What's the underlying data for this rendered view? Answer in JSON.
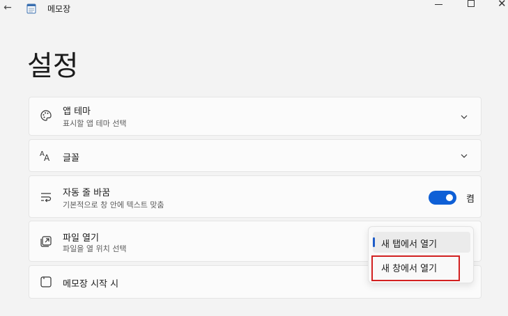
{
  "titlebar": {
    "app_title": "메모장",
    "back_icon": "arrow-left-icon",
    "app_icon": "notepad-icon"
  },
  "page": {
    "title": "설정"
  },
  "settings": [
    {
      "id": "theme",
      "label": "앱 테마",
      "description": "표시할 앱 테마 선택",
      "icon": "palette-icon"
    },
    {
      "id": "font",
      "label": "글꼴",
      "icon": "font-icon"
    },
    {
      "id": "wrap",
      "label": "자동 줄 바꿈",
      "description": "기본적으로 창 안에 텍스트 맞춤",
      "icon": "word-wrap-icon",
      "toggle_on": true,
      "toggle_label": "켬"
    },
    {
      "id": "open",
      "label": "파일 열기",
      "description": "파일을 열 위치 선택",
      "icon": "open-file-icon"
    },
    {
      "id": "start",
      "label": "메모장 시작 시",
      "icon": "window-icon"
    }
  ],
  "dropdown": {
    "options": [
      "새 탭에서 열기",
      "새 창에서 열기"
    ],
    "selected_index": 0
  },
  "colors": {
    "accent": "#0e5fd6",
    "highlight": "#d22020"
  }
}
